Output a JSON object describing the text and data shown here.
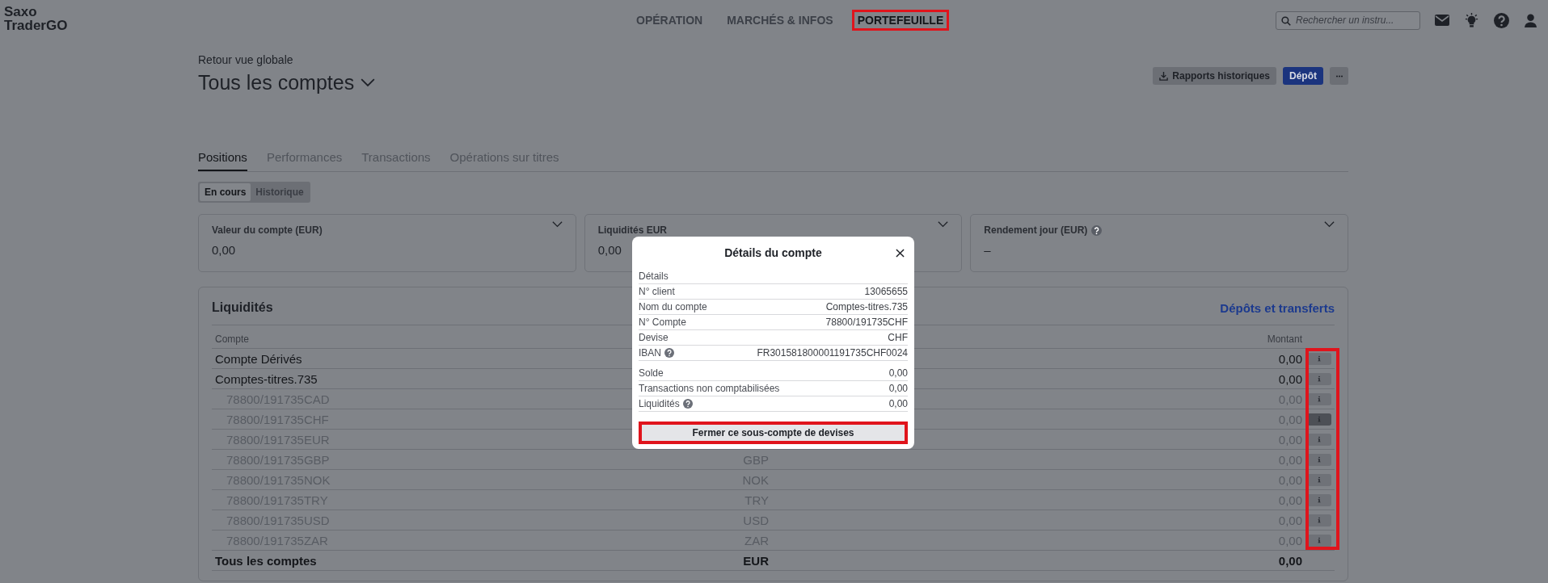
{
  "logo": [
    "Saxo",
    "TraderGO"
  ],
  "nav": [
    {
      "label": "OPÉRATION",
      "selected": false,
      "highlighted": false
    },
    {
      "label": "MARCHÉS & INFOS",
      "selected": false,
      "highlighted": false
    },
    {
      "label": "PORTEFEUILLE",
      "selected": true,
      "highlighted": true
    }
  ],
  "search": {
    "placeholder": "Rechercher un instru..."
  },
  "header": {
    "back_link": "Retour vue globale",
    "title": "Tous les comptes",
    "buttons": [
      {
        "kind": "download",
        "label": "Rapports historiques"
      },
      {
        "kind": "primary",
        "label": "Dépôt"
      },
      {
        "kind": "more"
      }
    ]
  },
  "tabs": [
    {
      "label": "Positions",
      "selected": true
    },
    {
      "label": "Performances",
      "selected": false
    },
    {
      "label": "Transactions",
      "selected": false
    },
    {
      "label": "Opérations sur titres",
      "selected": false
    }
  ],
  "segments": [
    {
      "label": "En cours",
      "selected": true
    },
    {
      "label": "Historique",
      "selected": false
    }
  ],
  "cards": [
    {
      "label": "Valeur du compte (EUR)",
      "value": "0,00",
      "help": false
    },
    {
      "label": "Liquidités EUR",
      "value": "0,00",
      "help": false
    },
    {
      "label": "Rendement jour (EUR)",
      "value": "–",
      "help": true
    }
  ],
  "liquidity": {
    "title": "Liquidités",
    "link": "Dépôts et transferts",
    "columns": [
      "Compte",
      "Montant"
    ],
    "info_column_highlighted": true,
    "rows": [
      {
        "kind": "account",
        "name": "Compte Dérivés",
        "amount": "0,00",
        "selected": false
      },
      {
        "kind": "account",
        "name": "Comptes-titres.735",
        "amount": "0,00",
        "selected": false,
        "children": [
          {
            "kind": "subaccount",
            "name": "78800/191735CAD",
            "amount": "0,00",
            "selected": false
          },
          {
            "kind": "subaccount",
            "name": "78800/191735CHF",
            "amount": "0,00",
            "selected": true
          },
          {
            "kind": "subaccount",
            "name": "78800/191735EUR",
            "amount": "0,00",
            "selected": false
          },
          {
            "kind": "subaccount",
            "name": "78800/191735GBP",
            "currency": "GBP",
            "amount": "0,00",
            "selected": false
          },
          {
            "kind": "subaccount",
            "name": "78800/191735NOK",
            "currency": "NOK",
            "amount": "0,00",
            "selected": false
          },
          {
            "kind": "subaccount",
            "name": "78800/191735TRY",
            "currency": "TRY",
            "amount": "0,00",
            "selected": false
          },
          {
            "kind": "subaccount",
            "name": "78800/191735USD",
            "currency": "USD",
            "amount": "0,00",
            "selected": false
          },
          {
            "kind": "subaccount",
            "name": "78800/191735ZAR",
            "currency": "ZAR",
            "amount": "0,00",
            "selected": false
          }
        ]
      }
    ],
    "total": {
      "name": "Tous les comptes",
      "currency": "EUR",
      "amount": "0,00"
    }
  },
  "modal": {
    "title": "Détails du compte",
    "sections": [
      {
        "heading": "Détails",
        "rows": [
          {
            "label": "N° client",
            "value": "13065655",
            "help": false
          },
          {
            "label": "Nom du compte",
            "value": "Comptes-titres.735",
            "help": false
          },
          {
            "label": "N° Compte",
            "value": "78800/191735CHF",
            "help": false
          },
          {
            "label": "Devise",
            "value": "CHF",
            "help": false
          },
          {
            "label": "IBAN",
            "value": "FR301581800001191735CHF0024",
            "help": true
          }
        ]
      },
      {
        "rows": [
          {
            "label": "Solde",
            "value": "0,00",
            "help": false
          },
          {
            "label": "Transactions non comptabilisées",
            "value": "0,00",
            "help": false
          },
          {
            "label": "Liquidités",
            "value": "0,00",
            "help": true
          }
        ]
      }
    ],
    "action": {
      "label": "Fermer ce sous-compte de devises",
      "highlighted": true
    }
  }
}
